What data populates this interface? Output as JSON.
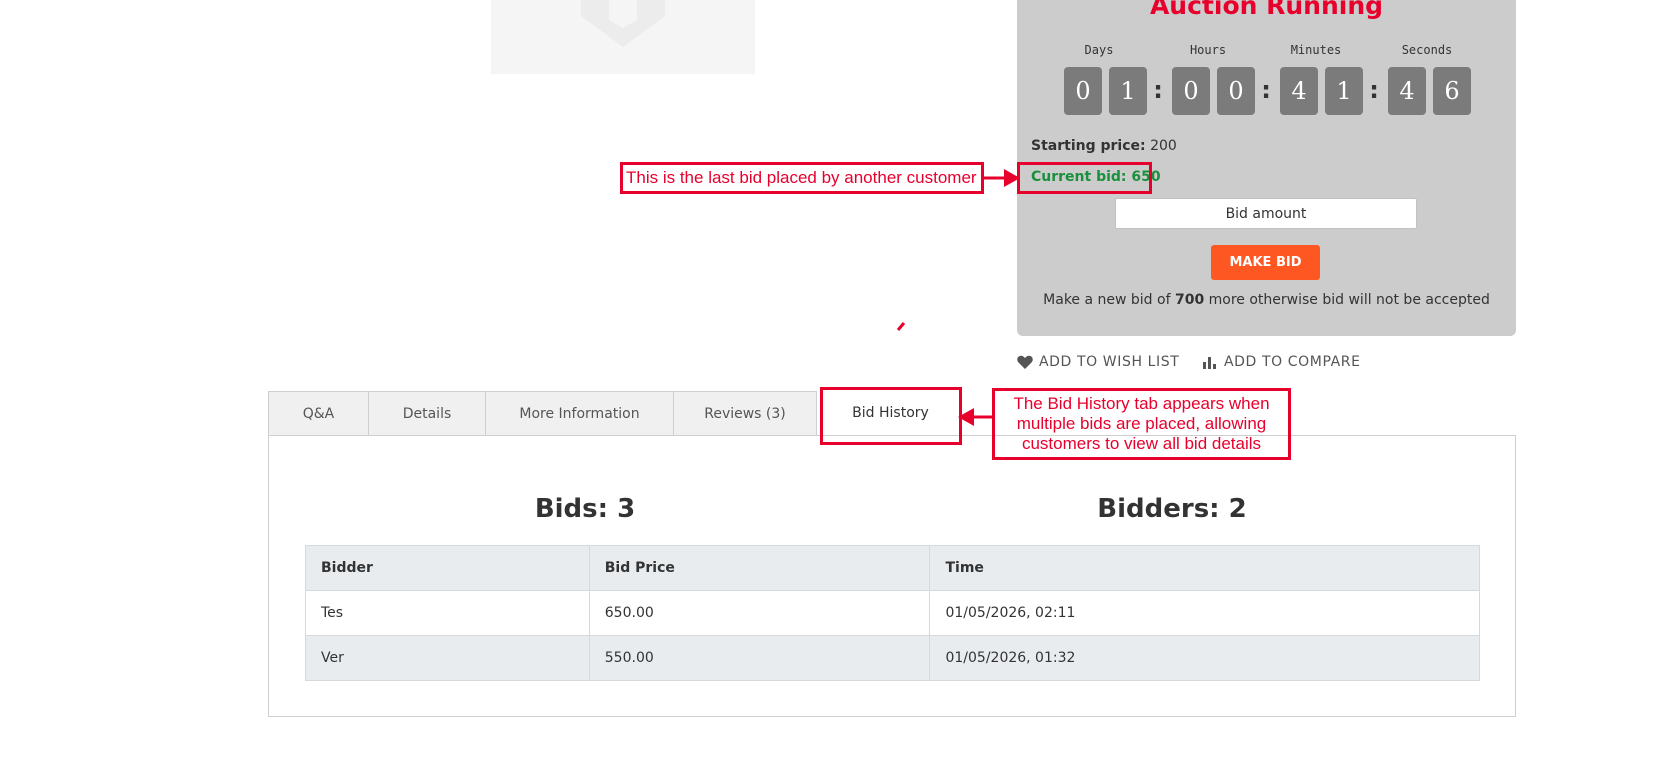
{
  "auction": {
    "title": "Auction Running",
    "countdown": {
      "labels": [
        "Days",
        "Hours",
        "Minutes",
        "Seconds"
      ],
      "digits": [
        "0",
        "1",
        "0",
        "0",
        "4",
        "1",
        "4",
        "6"
      ],
      "separator": ":"
    },
    "starting_price_label": "Starting price:",
    "starting_price_value": "200",
    "current_bid": "Current bid: 650",
    "bid_input_placeholder": "Bid amount",
    "make_bid_label": "MAKE BID",
    "note_prefix": "Make a new bid of",
    "note_amount": "700",
    "note_suffix": "more otherwise bid will not be accepted"
  },
  "actions": {
    "wish_list": "ADD TO WISH LIST",
    "compare": "ADD TO COMPARE"
  },
  "tabs": [
    {
      "label": "Q&A",
      "active": false
    },
    {
      "label": "Details",
      "active": false
    },
    {
      "label": "More Information",
      "active": false
    },
    {
      "label": "Reviews (3)",
      "active": false
    },
    {
      "label": "Bid History",
      "active": true
    }
  ],
  "bid_history": {
    "bids": "Bids: 3",
    "bidders": "Bidders: 2",
    "columns": [
      "Bidder",
      "Bid Price",
      "Time"
    ],
    "rows": [
      [
        "Tes",
        "650.00",
        "01/05/2026, 02:11"
      ],
      [
        "Ver",
        "550.00",
        "01/05/2026, 01:32"
      ]
    ]
  },
  "annotations": {
    "last_bid": "This is the last bid placed by another customer",
    "bid_history": "The Bid History tab appears when multiple bids are placed, allowing customers to view all bid details"
  },
  "colors": {
    "annotation": "#e8002d",
    "auction_title": "#e8002d",
    "current_bid": "#1a8f3c",
    "make_bid_button": "#ff5722",
    "panel_bg": "#cccccc"
  }
}
